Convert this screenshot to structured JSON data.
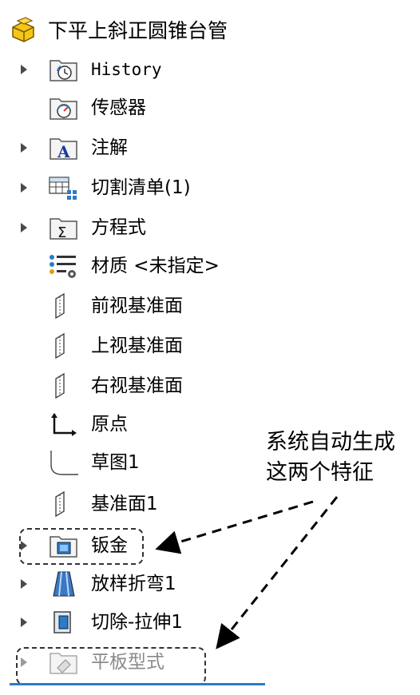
{
  "tree": {
    "root_label": "下平上斜正圆锥台管",
    "items": [
      {
        "label": "History",
        "icon": "history-folder-icon",
        "expandable": true
      },
      {
        "label": "传感器",
        "icon": "sensor-folder-icon",
        "expandable": false
      },
      {
        "label": "注解",
        "icon": "annotation-folder-icon",
        "expandable": true
      },
      {
        "label": "切割清单(1)",
        "icon": "cut-list-icon",
        "expandable": true
      },
      {
        "label": "方程式",
        "icon": "equation-folder-icon",
        "expandable": true
      },
      {
        "label": "材质 <未指定>",
        "icon": "material-icon",
        "expandable": false
      },
      {
        "label": "前视基准面",
        "icon": "plane-icon",
        "expandable": false
      },
      {
        "label": "上视基准面",
        "icon": "plane-icon",
        "expandable": false
      },
      {
        "label": "右视基准面",
        "icon": "plane-icon",
        "expandable": false
      },
      {
        "label": "原点",
        "icon": "origin-icon",
        "expandable": false
      },
      {
        "label": "草图1",
        "icon": "sketch-icon",
        "expandable": false
      },
      {
        "label": "基准面1",
        "icon": "plane-icon",
        "expandable": false
      },
      {
        "label": "钣金",
        "icon": "sheet-metal-folder-icon",
        "expandable": true
      },
      {
        "label": "放样折弯1",
        "icon": "lofted-bend-icon",
        "expandable": true
      },
      {
        "label": "切除-拉伸1",
        "icon": "cut-extrude-icon",
        "expandable": true
      },
      {
        "label": "平板型式",
        "icon": "flat-pattern-icon",
        "expandable": true
      }
    ]
  },
  "callout": {
    "line1": "系统自动生成",
    "line2": "这两个特征"
  },
  "colors": {
    "accent_bar": "#2a7bc9",
    "disabled_text": "#8a8a8a"
  }
}
